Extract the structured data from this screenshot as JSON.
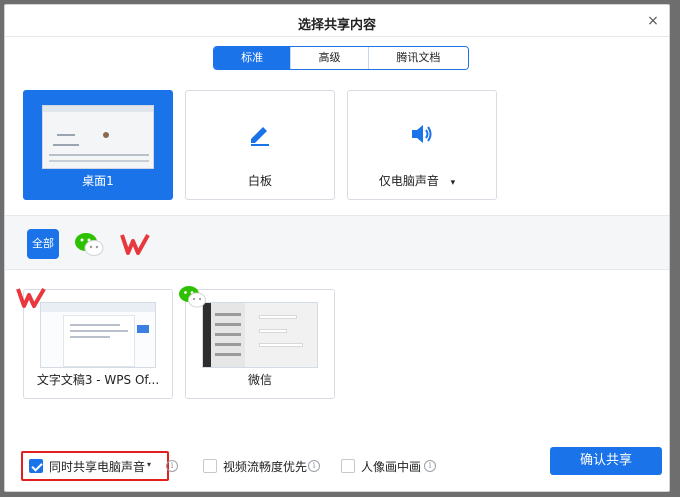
{
  "dialog": {
    "title": "选择共享内容",
    "close_label": "×"
  },
  "tabs": [
    {
      "label": "标准",
      "active": true
    },
    {
      "label": "高级",
      "active": false
    },
    {
      "label": "腾讯文档",
      "active": false
    }
  ],
  "screens": [
    {
      "label": "桌面1",
      "selected": true
    },
    {
      "label": "白板",
      "icon": "pen-icon"
    },
    {
      "label": "仅电脑声音",
      "icon": "speaker-icon",
      "caret": "▾"
    }
  ],
  "filters": {
    "all_label": "全部",
    "icons": [
      "wechat-icon",
      "wps-icon"
    ]
  },
  "apps": [
    {
      "label": "文字文稿3 - WPS Of...",
      "badge": "wps-icon"
    },
    {
      "label": "微信",
      "badge": "wechat-icon"
    }
  ],
  "options": {
    "share_audio": {
      "label": "同时共享电脑声音",
      "checked": true,
      "caret": "▾",
      "info": "i"
    },
    "video_smooth": {
      "label": "视频流畅度优先",
      "checked": false,
      "info": "i"
    },
    "pip": {
      "label": "人像画中画",
      "checked": false,
      "info": "i"
    }
  },
  "confirm_label": "确认共享",
  "colors": {
    "accent": "#1a73e8",
    "highlight": "#e0211f",
    "wechat": "#2dc100",
    "wps": "#e8383d"
  }
}
